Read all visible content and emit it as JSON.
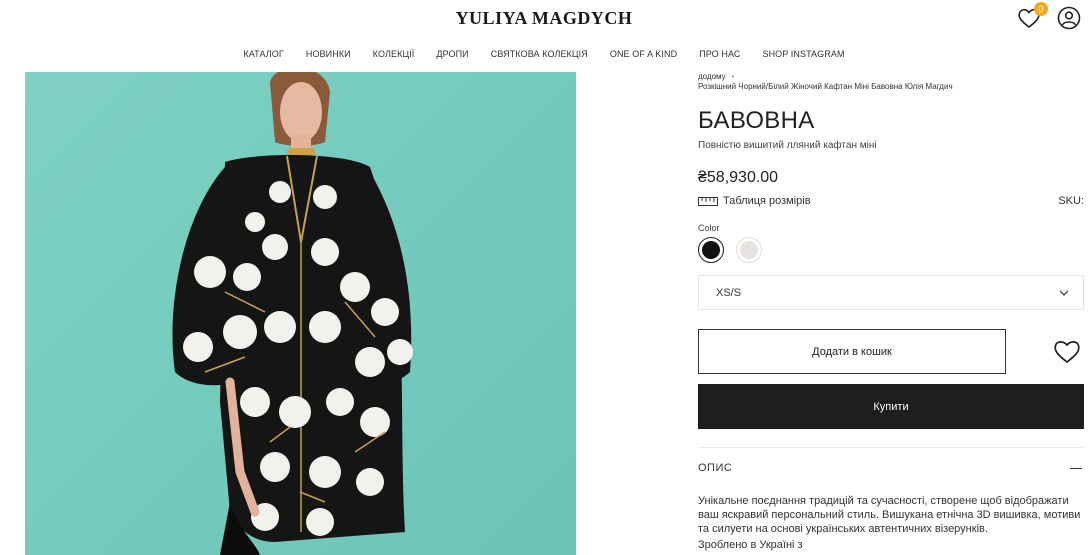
{
  "header": {
    "logo": "YULIYA MAGDYCH",
    "wishlist_count": "0",
    "icons": [
      "heart-icon",
      "user-icon"
    ]
  },
  "nav": {
    "items": [
      "КАТАЛОГ",
      "НОВИНКИ",
      "КОЛЕКЦІЇ",
      "ДРОПИ",
      "СВЯТКОВА КОЛЕКЦІЯ",
      "ONE OF A KIND",
      "ПРО НАС",
      "SHOP INSTAGRAM"
    ]
  },
  "breadcrumb": {
    "home": "додому",
    "current": "Розкішний Чорний/Білий Жіночий Кафтан Міні Бавовна Юлія Магдич"
  },
  "product": {
    "title": "БАВОВНА",
    "subtitle": "Повністю вишитий лляний кафтан міні",
    "price": "₴58,930.00",
    "size_table_label": "Таблиця розмірів",
    "sku_label": "SKU:",
    "color_label": "Color",
    "colors": [
      {
        "name": "black",
        "hex": "#111111"
      },
      {
        "name": "white",
        "hex": "#e6e3df"
      }
    ],
    "selected_size": "XS/S",
    "add_to_cart": "Додати в кошик",
    "buy": "Купити",
    "description_title": "ОПИС",
    "description": "Унікальне поєднання традицій та сучасності, створене щоб відображати ваш яскравий персональний стиль. Вишукана етнічна 3D вишивка, мотиви та силуети на основі українських автентичних візерунків.",
    "made_in": "Зроблено в Україні з"
  },
  "colors": {
    "accent_badge": "#f4a81d",
    "image_background": "#74cbbd",
    "buy_button": "#1e1e1e"
  }
}
